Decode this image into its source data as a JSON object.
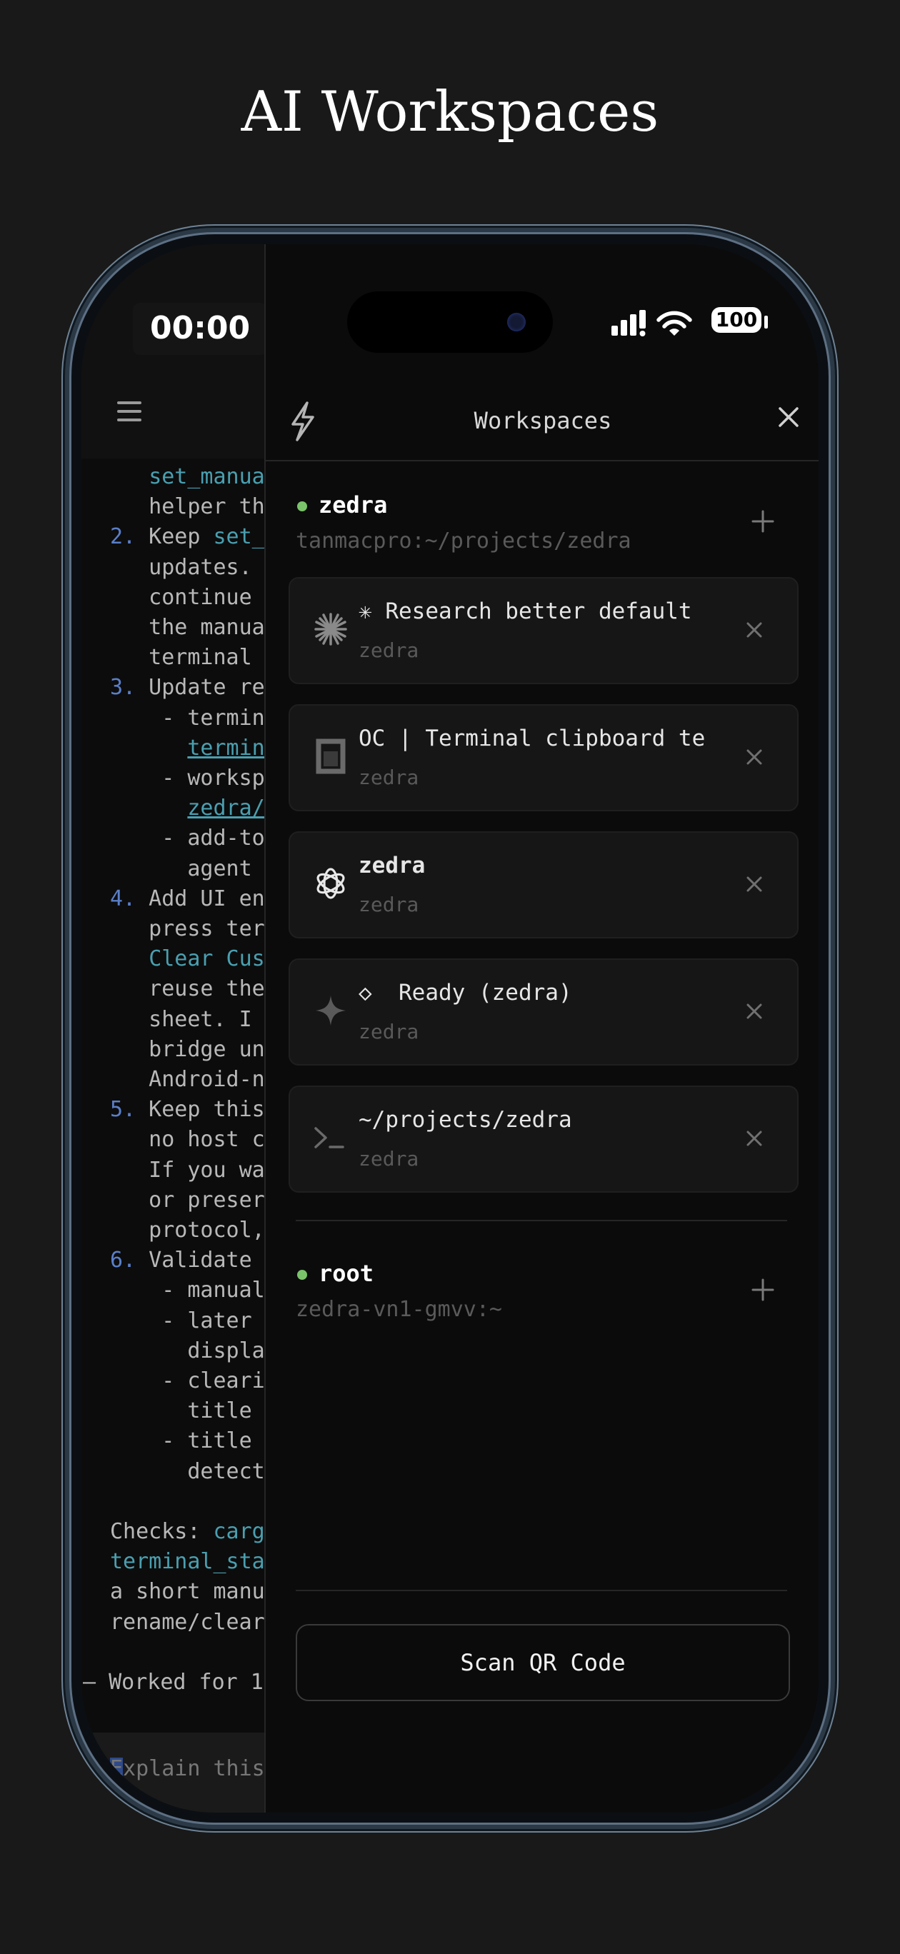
{
  "headline": "AI Workspaces",
  "status_bar": {
    "time": "00:00",
    "battery": "100"
  },
  "terminal": {
    "lines": [
      {
        "parts": [
          [
            "   ",
            ""
          ],
          [
            "set_manua",
            "hl"
          ]
        ]
      },
      {
        "parts": [
          [
            "   helper th",
            ""
          ]
        ]
      },
      {
        "parts": [
          [
            "2.",
            "num"
          ],
          [
            " Keep ",
            ""
          ],
          [
            "set_",
            "hl"
          ]
        ]
      },
      {
        "parts": [
          [
            "   updates.",
            ""
          ]
        ]
      },
      {
        "parts": [
          [
            "   continue",
            ""
          ]
        ]
      },
      {
        "parts": [
          [
            "   the manua",
            ""
          ]
        ]
      },
      {
        "parts": [
          [
            "   terminal",
            ""
          ]
        ]
      },
      {
        "parts": [
          [
            "3.",
            "num"
          ],
          [
            " Update re",
            ""
          ]
        ]
      },
      {
        "parts": [
          [
            "    - termin",
            ""
          ]
        ]
      },
      {
        "parts": [
          [
            "      ",
            ""
          ],
          [
            "termin",
            "ul"
          ]
        ]
      },
      {
        "parts": [
          [
            "    - worksp",
            ""
          ]
        ]
      },
      {
        "parts": [
          [
            "      ",
            ""
          ],
          [
            "zedra/",
            "ul"
          ]
        ]
      },
      {
        "parts": [
          [
            "    - add-to",
            ""
          ]
        ]
      },
      {
        "parts": [
          [
            "      agent",
            ""
          ]
        ]
      },
      {
        "parts": [
          [
            "4.",
            "num"
          ],
          [
            " Add UI en",
            ""
          ]
        ]
      },
      {
        "parts": [
          [
            "   press ter",
            ""
          ]
        ]
      },
      {
        "parts": [
          [
            "   ",
            ""
          ],
          [
            "Clear Cus",
            "hl"
          ]
        ]
      },
      {
        "parts": [
          [
            "   reuse the",
            ""
          ]
        ]
      },
      {
        "parts": [
          [
            "   sheet. I",
            ""
          ]
        ]
      },
      {
        "parts": [
          [
            "   bridge un",
            ""
          ]
        ]
      },
      {
        "parts": [
          [
            "   Android-n",
            ""
          ]
        ]
      },
      {
        "parts": [
          [
            "5.",
            "num"
          ],
          [
            " Keep this",
            ""
          ]
        ]
      },
      {
        "parts": [
          [
            "   no host c",
            ""
          ]
        ]
      },
      {
        "parts": [
          [
            "   If you wa",
            ""
          ]
        ]
      },
      {
        "parts": [
          [
            "   or preser",
            ""
          ]
        ]
      },
      {
        "parts": [
          [
            "   protocol,",
            ""
          ]
        ]
      },
      {
        "parts": [
          [
            "6.",
            "num"
          ],
          [
            " Validate",
            ""
          ]
        ]
      },
      {
        "parts": [
          [
            "    - manual",
            ""
          ]
        ]
      },
      {
        "parts": [
          [
            "    - later",
            ""
          ]
        ]
      },
      {
        "parts": [
          [
            "      displa",
            ""
          ]
        ]
      },
      {
        "parts": [
          [
            "    - cleari",
            ""
          ]
        ]
      },
      {
        "parts": [
          [
            "      title",
            ""
          ]
        ]
      },
      {
        "parts": [
          [
            "    - title",
            ""
          ]
        ]
      },
      {
        "parts": [
          [
            "      detect",
            ""
          ]
        ]
      },
      {
        "parts": [
          [
            "",
            ""
          ]
        ]
      },
      {
        "parts": [
          [
            "Checks: ",
            ""
          ],
          [
            "carg",
            "hl"
          ]
        ]
      },
      {
        "parts": [
          [
            "terminal_sta",
            "hl"
          ]
        ]
      },
      {
        "parts": [
          [
            "a short manu",
            ""
          ]
        ]
      },
      {
        "parts": [
          [
            "rename/clear",
            ""
          ]
        ]
      },
      {
        "parts": [
          [
            "",
            ""
          ]
        ]
      },
      {
        "parts": [
          [
            "— Worked for 1",
            "dim"
          ]
        ]
      }
    ],
    "input_text": "Explain this"
  },
  "drawer": {
    "title": "Workspaces",
    "hosts": [
      {
        "name": "zedra",
        "address": "tanmacpro:~/projects/zedra",
        "sessions": [
          {
            "icon": "claude-asterisk-icon",
            "title": "✳ Research better default",
            "subtitle": "zedra"
          },
          {
            "icon": "opencode-square-icon",
            "title": "OC | Terminal clipboard te",
            "subtitle": "zedra"
          },
          {
            "icon": "openai-knot-icon",
            "title": "zedra",
            "subtitle": "zedra"
          },
          {
            "icon": "gemini-sparkle-icon",
            "title": "◇  Ready (zedra)",
            "subtitle": "zedra"
          },
          {
            "icon": "terminal-prompt-icon",
            "title": "~/projects/zedra",
            "subtitle": "zedra"
          }
        ]
      },
      {
        "name": "root",
        "address": "zedra-vn1-gmvv:~",
        "sessions": []
      }
    ],
    "scan_label": "Scan QR Code"
  },
  "colors": {
    "online_dot": "#7ac36a",
    "accent_link": "#4a9fb0",
    "list_number": "#5a7fc8"
  }
}
